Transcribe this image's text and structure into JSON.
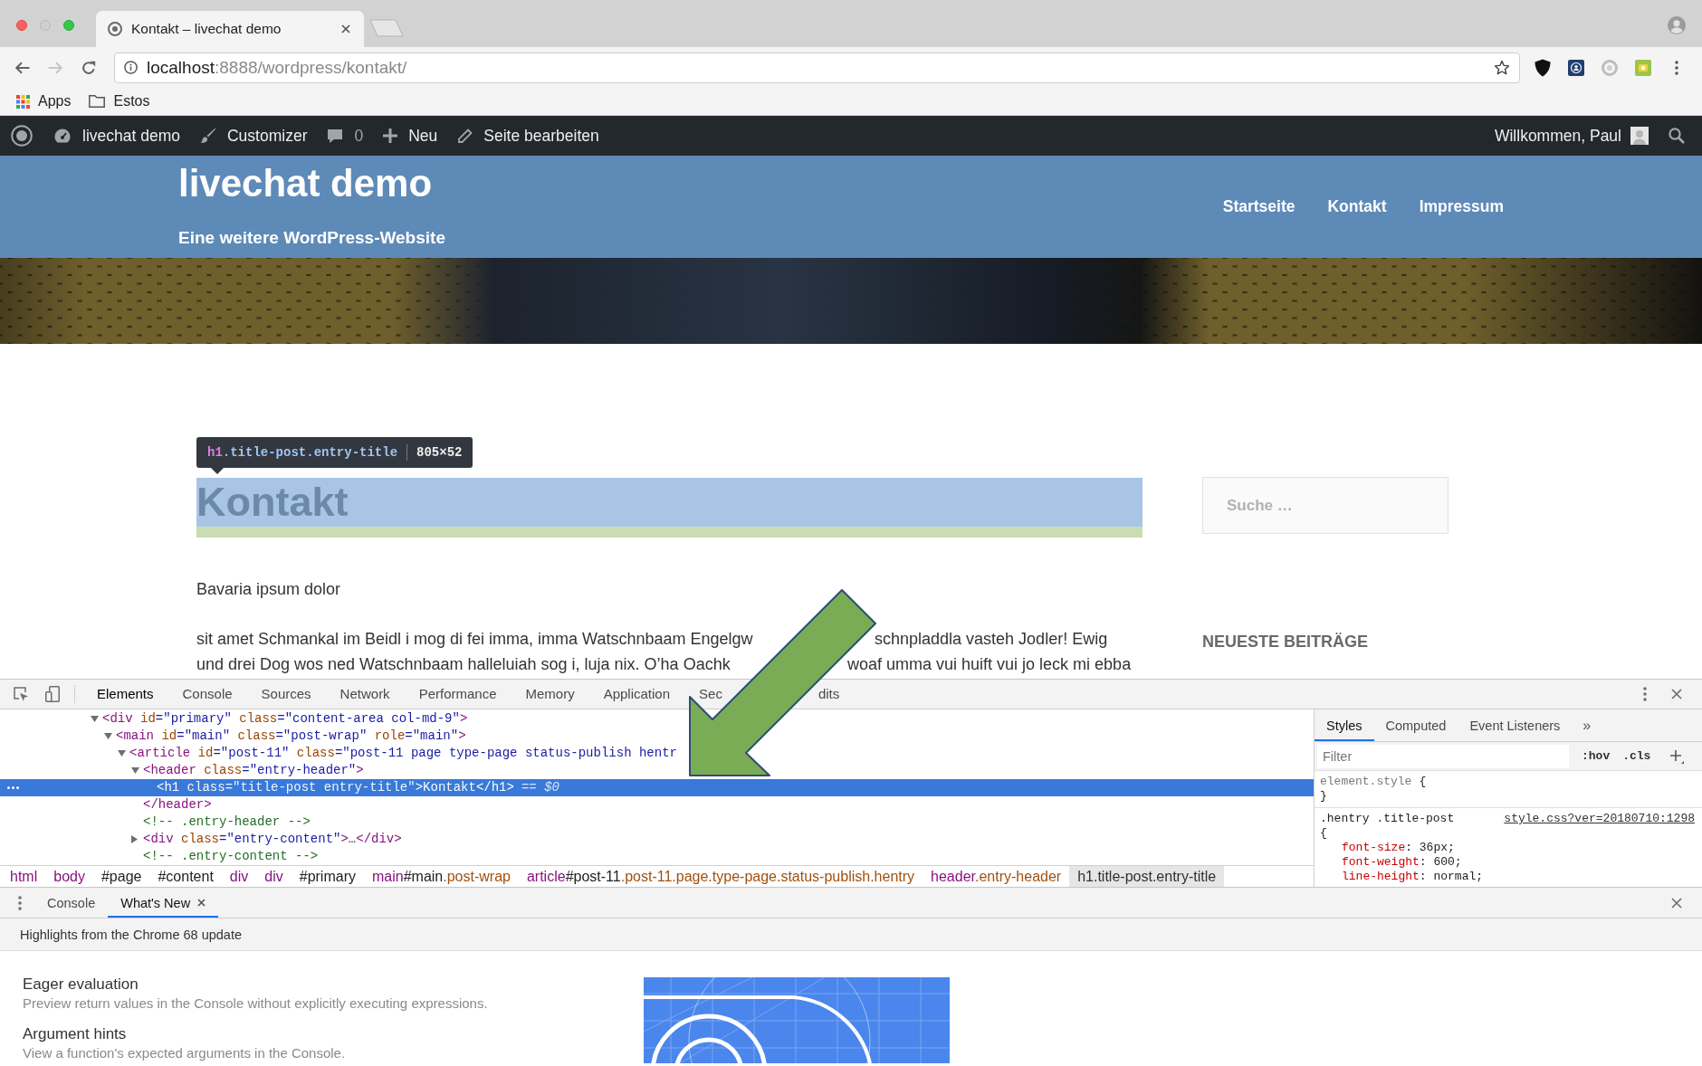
{
  "browser": {
    "tab": {
      "title": "Kontakt – livechat demo"
    },
    "nav_buttons": [
      {
        "kind": "back",
        "disabled": false
      },
      {
        "kind": "forward",
        "disabled": true
      },
      {
        "kind": "reload",
        "disabled": false
      }
    ],
    "address": {
      "host": "localhost",
      "path": ":8888/wordpress/kontakt/"
    },
    "bookmarks": [
      {
        "kind": "apps",
        "label": "Apps"
      },
      {
        "kind": "folder",
        "label": "Estos"
      }
    ]
  },
  "admin_bar": {
    "items": [
      {
        "kind": "logo"
      },
      {
        "kind": "site",
        "label": "livechat demo"
      },
      {
        "kind": "customize",
        "label": "Customizer"
      },
      {
        "kind": "comments",
        "label": "0"
      },
      {
        "kind": "new",
        "label": "Neu"
      },
      {
        "kind": "edit",
        "label": "Seite bearbeiten"
      }
    ],
    "account": "Willkommen, Paul"
  },
  "site_header": {
    "title": "livechat demo",
    "tagline": "Eine weitere WordPress-Website",
    "nav": [
      "Startseite",
      "Kontakt",
      "Impressum"
    ]
  },
  "inspector_tooltip": {
    "tag": "h1",
    "selector": ".title-post.entry-title",
    "size": "805×52"
  },
  "page": {
    "title": "Kontakt",
    "intro": "Bavaria ipsum dolor",
    "paragraph_lines": [
      [
        "sit amet Schmankal im Beidl i mog di fei imma, imma Watschnbaam Engelgw",
        "schnpladdla vasteh Jodler! Ewig"
      ],
      [
        "und drei Dog wos ned Watschnbaam halleluiah sog i, luja nix. O’ha Oachk",
        "woaf umma vui huift vui jo leck mi ebba"
      ]
    ]
  },
  "sidebar": {
    "search": {
      "placeholder": "Suche …"
    },
    "heading": "NEUESTE BEITRÄGE"
  },
  "annotations": [
    {
      "kind": "arrow"
    }
  ],
  "devtools": {
    "tabs": [
      {
        "label": "Elements",
        "selected": true,
        "covered_after": false
      },
      {
        "label": "Console",
        "selected": false,
        "covered_after": false
      },
      {
        "label": "Sources",
        "selected": false,
        "covered_after": false
      },
      {
        "label": "Network",
        "selected": false,
        "covered_after": false
      },
      {
        "label": "Performance",
        "selected": false,
        "covered_after": false
      },
      {
        "label": "Memory",
        "selected": false,
        "covered_after": false
      },
      {
        "label": "Application",
        "selected": false,
        "covered_after": false
      },
      {
        "label": "Sec",
        "selected": false,
        "covered_after": true
      },
      {
        "label": "dits",
        "selected": false,
        "covered_after": false
      }
    ],
    "dom_tree": [
      {
        "kind": "element",
        "expanded": true,
        "selected": false,
        "open": [
          {
            "kind": "tag",
            "text": "<div"
          },
          {
            "kind": "attr",
            "text": " id"
          },
          {
            "kind": "value",
            "text": "=\"primary\""
          },
          {
            "kind": "attr",
            "text": " class"
          },
          {
            "kind": "value",
            "text": "=\"content-area col-md-9\""
          },
          {
            "kind": "tag",
            "text": ">"
          }
        ],
        "children": [
          {
            "kind": "element",
            "expanded": true,
            "selected": false,
            "open": [
              {
                "kind": "tag",
                "text": "<main"
              },
              {
                "kind": "attr",
                "text": " id"
              },
              {
                "kind": "value",
                "text": "=\"main\""
              },
              {
                "kind": "attr",
                "text": " class"
              },
              {
                "kind": "value",
                "text": "=\"post-wrap\""
              },
              {
                "kind": "attr",
                "text": " role"
              },
              {
                "kind": "value",
                "text": "=\"main\""
              },
              {
                "kind": "tag",
                "text": ">"
              }
            ],
            "children": [
              {
                "kind": "element",
                "expanded": true,
                "selected": false,
                "open": [
                  {
                    "kind": "tag",
                    "text": "<article"
                  },
                  {
                    "kind": "attr",
                    "text": " id"
                  },
                  {
                    "kind": "value",
                    "text": "=\"post-11\""
                  },
                  {
                    "kind": "attr",
                    "text": " class"
                  },
                  {
                    "kind": "value",
                    "text": "=\"post-11 page type-page status-publish hentr"
                  }
                ],
                "children": [
                  {
                    "kind": "element",
                    "expanded": true,
                    "selected": false,
                    "open": [
                      {
                        "kind": "tag",
                        "text": "<header"
                      },
                      {
                        "kind": "attr",
                        "text": " class"
                      },
                      {
                        "kind": "value",
                        "text": "=\"entry-header\""
                      },
                      {
                        "kind": "tag",
                        "text": ">"
                      }
                    ],
                    "children": [
                      {
                        "kind": "element",
                        "selected": true,
                        "open": [
                          {
                            "kind": "tag",
                            "text": "<h1"
                          },
                          {
                            "kind": "attr",
                            "text": " class"
                          },
                          {
                            "kind": "value",
                            "text": "=\"title-post entry-title\""
                          },
                          {
                            "kind": "tag",
                            "text": ">"
                          },
                          {
                            "kind": "text",
                            "text": "Kontakt"
                          },
                          {
                            "kind": "tag",
                            "text": "</h1>"
                          }
                        ],
                        "ref": "== $0"
                      }
                    ],
                    "close": [
                      {
                        "kind": "tag",
                        "text": "</header>"
                      }
                    ]
                  },
                  {
                    "kind": "comment",
                    "selected": false,
                    "open": [
                      {
                        "kind": "text",
                        "text": "<!-- .entry-header -->"
                      }
                    ]
                  },
                  {
                    "kind": "element",
                    "expanded": false,
                    "selected": false,
                    "open": [
                      {
                        "kind": "tag",
                        "text": "<div"
                      },
                      {
                        "kind": "attr",
                        "text": " class"
                      },
                      {
                        "kind": "value",
                        "text": "=\"entry-content\""
                      },
                      {
                        "kind": "tag",
                        "text": ">"
                      },
                      {
                        "kind": "text",
                        "text": "…"
                      },
                      {
                        "kind": "tag",
                        "text": "</div>"
                      }
                    ]
                  },
                  {
                    "kind": "comment",
                    "selected": false,
                    "open": [
                      {
                        "kind": "text",
                        "text": "<!-- .entry-content -->"
                      }
                    ]
                  }
                ]
              }
            ]
          }
        ]
      }
    ],
    "breadcrumbs": [
      {
        "tag": "html",
        "selected": false
      },
      {
        "tag": "body",
        "selected": false
      },
      {
        "id": "#page",
        "selected": false
      },
      {
        "id": "#content",
        "selected": false
      },
      {
        "tag": "div",
        "selected": false
      },
      {
        "tag": "div",
        "selected": false
      },
      {
        "id": "#primary",
        "selected": false
      },
      {
        "tag": "main",
        "id": "#main",
        "classes": ".post-wrap",
        "selected": false
      },
      {
        "tag": "article",
        "id": "#post-11",
        "classes": ".post-11.page.type-page.status-publish.hentry",
        "selected": false
      },
      {
        "tag": "header",
        "classes": ".entry-header",
        "selected": false
      },
      {
        "tag": "h1",
        "classes": ".title-post.entry-title",
        "selected": true
      }
    ],
    "styles": {
      "tabs": [
        {
          "label": "Styles",
          "selected": true
        },
        {
          "label": "Computed",
          "selected": false
        },
        {
          "label": "Event Listeners",
          "selected": false
        }
      ],
      "overflow": "»",
      "filter": {
        "placeholder": "Filter"
      },
      "toggles": [
        ":hov",
        ".cls"
      ],
      "rules": [
        {
          "kind": "inline",
          "selector": "element.style",
          "open": "{",
          "close": "}"
        },
        {
          "kind": "stylesheet",
          "selector": ".hentry .title-post",
          "source": "style.css?ver=20180710:1298",
          "open": "{",
          "declarations": [
            [
              {
                "kind": "property",
                "text": "font-size"
              },
              {
                "kind": "value",
                "text": ": 36px;"
              }
            ],
            [
              {
                "kind": "property",
                "text": "font-weight"
              },
              {
                "kind": "value",
                "text": ": 600;"
              }
            ],
            [
              {
                "kind": "property",
                "text": "line-height"
              },
              {
                "kind": "value",
                "text": ": normal;"
              }
            ]
          ]
        }
      ]
    }
  },
  "drawer": {
    "tabs": [
      {
        "label": "Console",
        "selected": false,
        "closable": false
      },
      {
        "label": "What's New",
        "selected": true,
        "closable": true
      }
    ],
    "subtitle": "Highlights from the Chrome 68 update",
    "features": [
      {
        "title": "Eager evaluation",
        "description": "Preview return values in the Console without explicitly executing expressions."
      },
      {
        "title": "Argument hints",
        "description": "View a function's expected arguments in the Console."
      }
    ]
  }
}
